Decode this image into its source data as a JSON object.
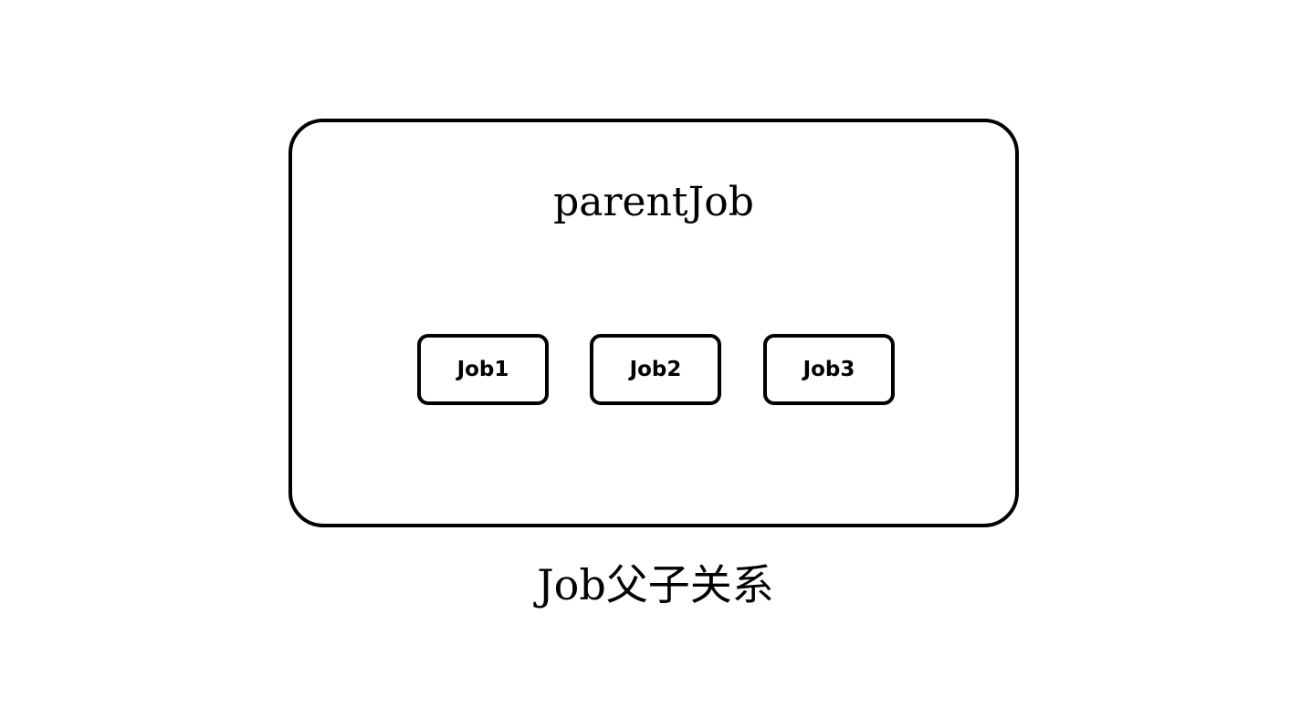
{
  "diagram": {
    "parent": {
      "label": "parentJob"
    },
    "children": [
      {
        "label": "Job1"
      },
      {
        "label": "Job2"
      },
      {
        "label": "Job3"
      }
    ],
    "caption": "Job父子关系"
  }
}
